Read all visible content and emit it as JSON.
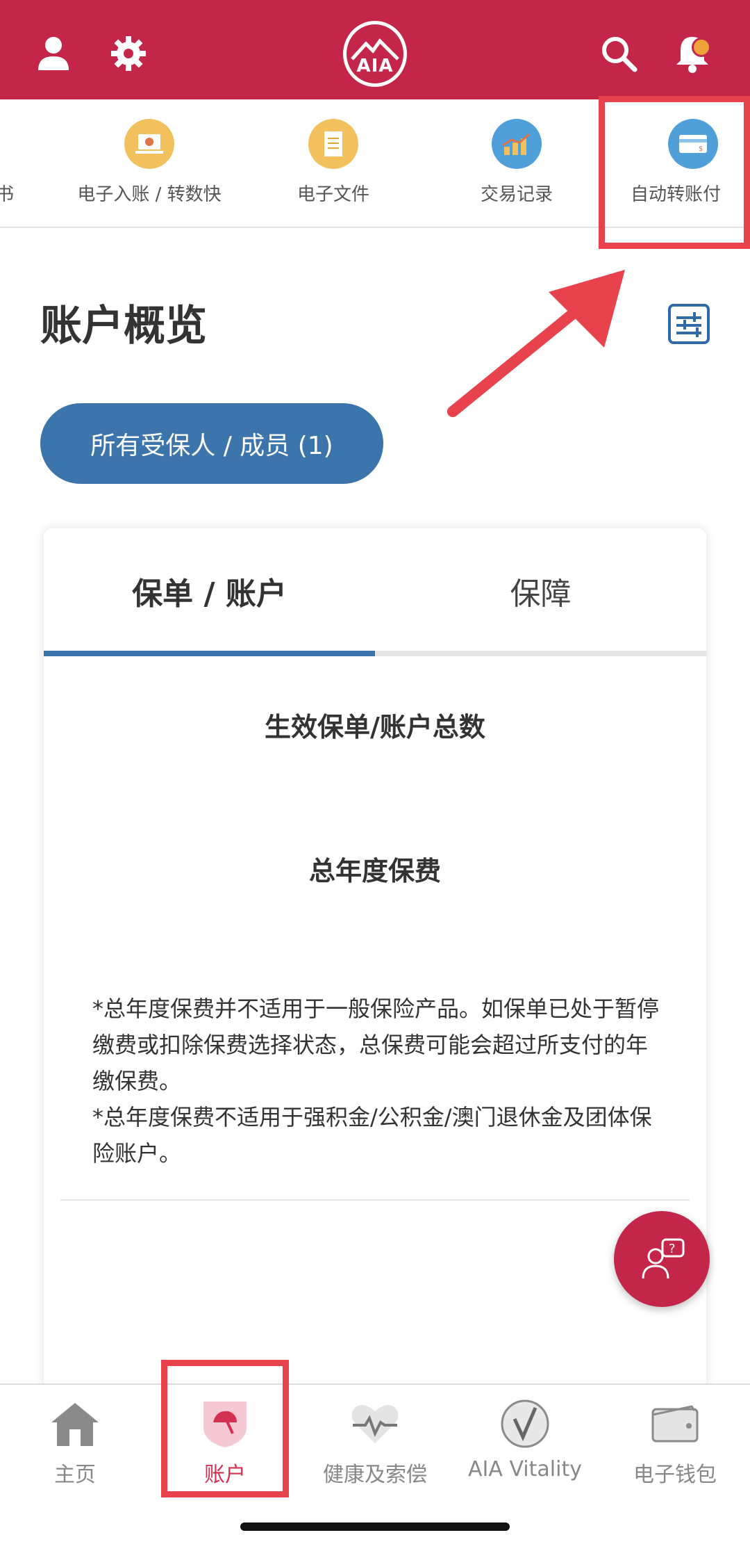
{
  "header": {
    "logo_text": "AIA",
    "colors": {
      "brand": "#c4264a",
      "accent_blue": "#3b75ab",
      "highlight": "#e8424d"
    },
    "icons": [
      "profile-icon",
      "settings-icon",
      "search-icon",
      "bell-icon"
    ]
  },
  "quick_actions": [
    {
      "label": "书",
      "icon": "statement-icon"
    },
    {
      "label": "电子入账 / 转数快",
      "icon": "laptop-transfer-icon"
    },
    {
      "label": "电子文件",
      "icon": "document-icon"
    },
    {
      "label": "交易记录",
      "icon": "transaction-chart-icon"
    },
    {
      "label": "自动转账付",
      "icon": "card-autopay-icon"
    }
  ],
  "overview": {
    "title": "账户概览",
    "filter_button": "所有受保人 / 成员 (1)"
  },
  "card": {
    "tabs": [
      "保单 / 账户",
      "保障"
    ],
    "active_tab": 0,
    "policies_total_label": "生效保单/账户总数",
    "annual_premium_label": "总年度保费",
    "notes": [
      "*总年度保费并不适用于一般保险产品。如保单已处于暂停缴费或扣除保费选择状态，总保费可能会超过所支付的年缴保费。",
      "*总年度保费不适用于强积金/公积金/澳门退休金及团体保险账户。"
    ]
  },
  "bottom_nav": {
    "items": [
      {
        "label": "主页",
        "icon": "home-icon"
      },
      {
        "label": "账户",
        "icon": "umbrella-shield-icon",
        "active": true
      },
      {
        "label": "健康及索偿",
        "icon": "heart-pulse-icon"
      },
      {
        "label": "AIA Vitality",
        "icon": "vitality-icon"
      },
      {
        "label": "电子钱包",
        "icon": "wallet-icon"
      }
    ]
  }
}
